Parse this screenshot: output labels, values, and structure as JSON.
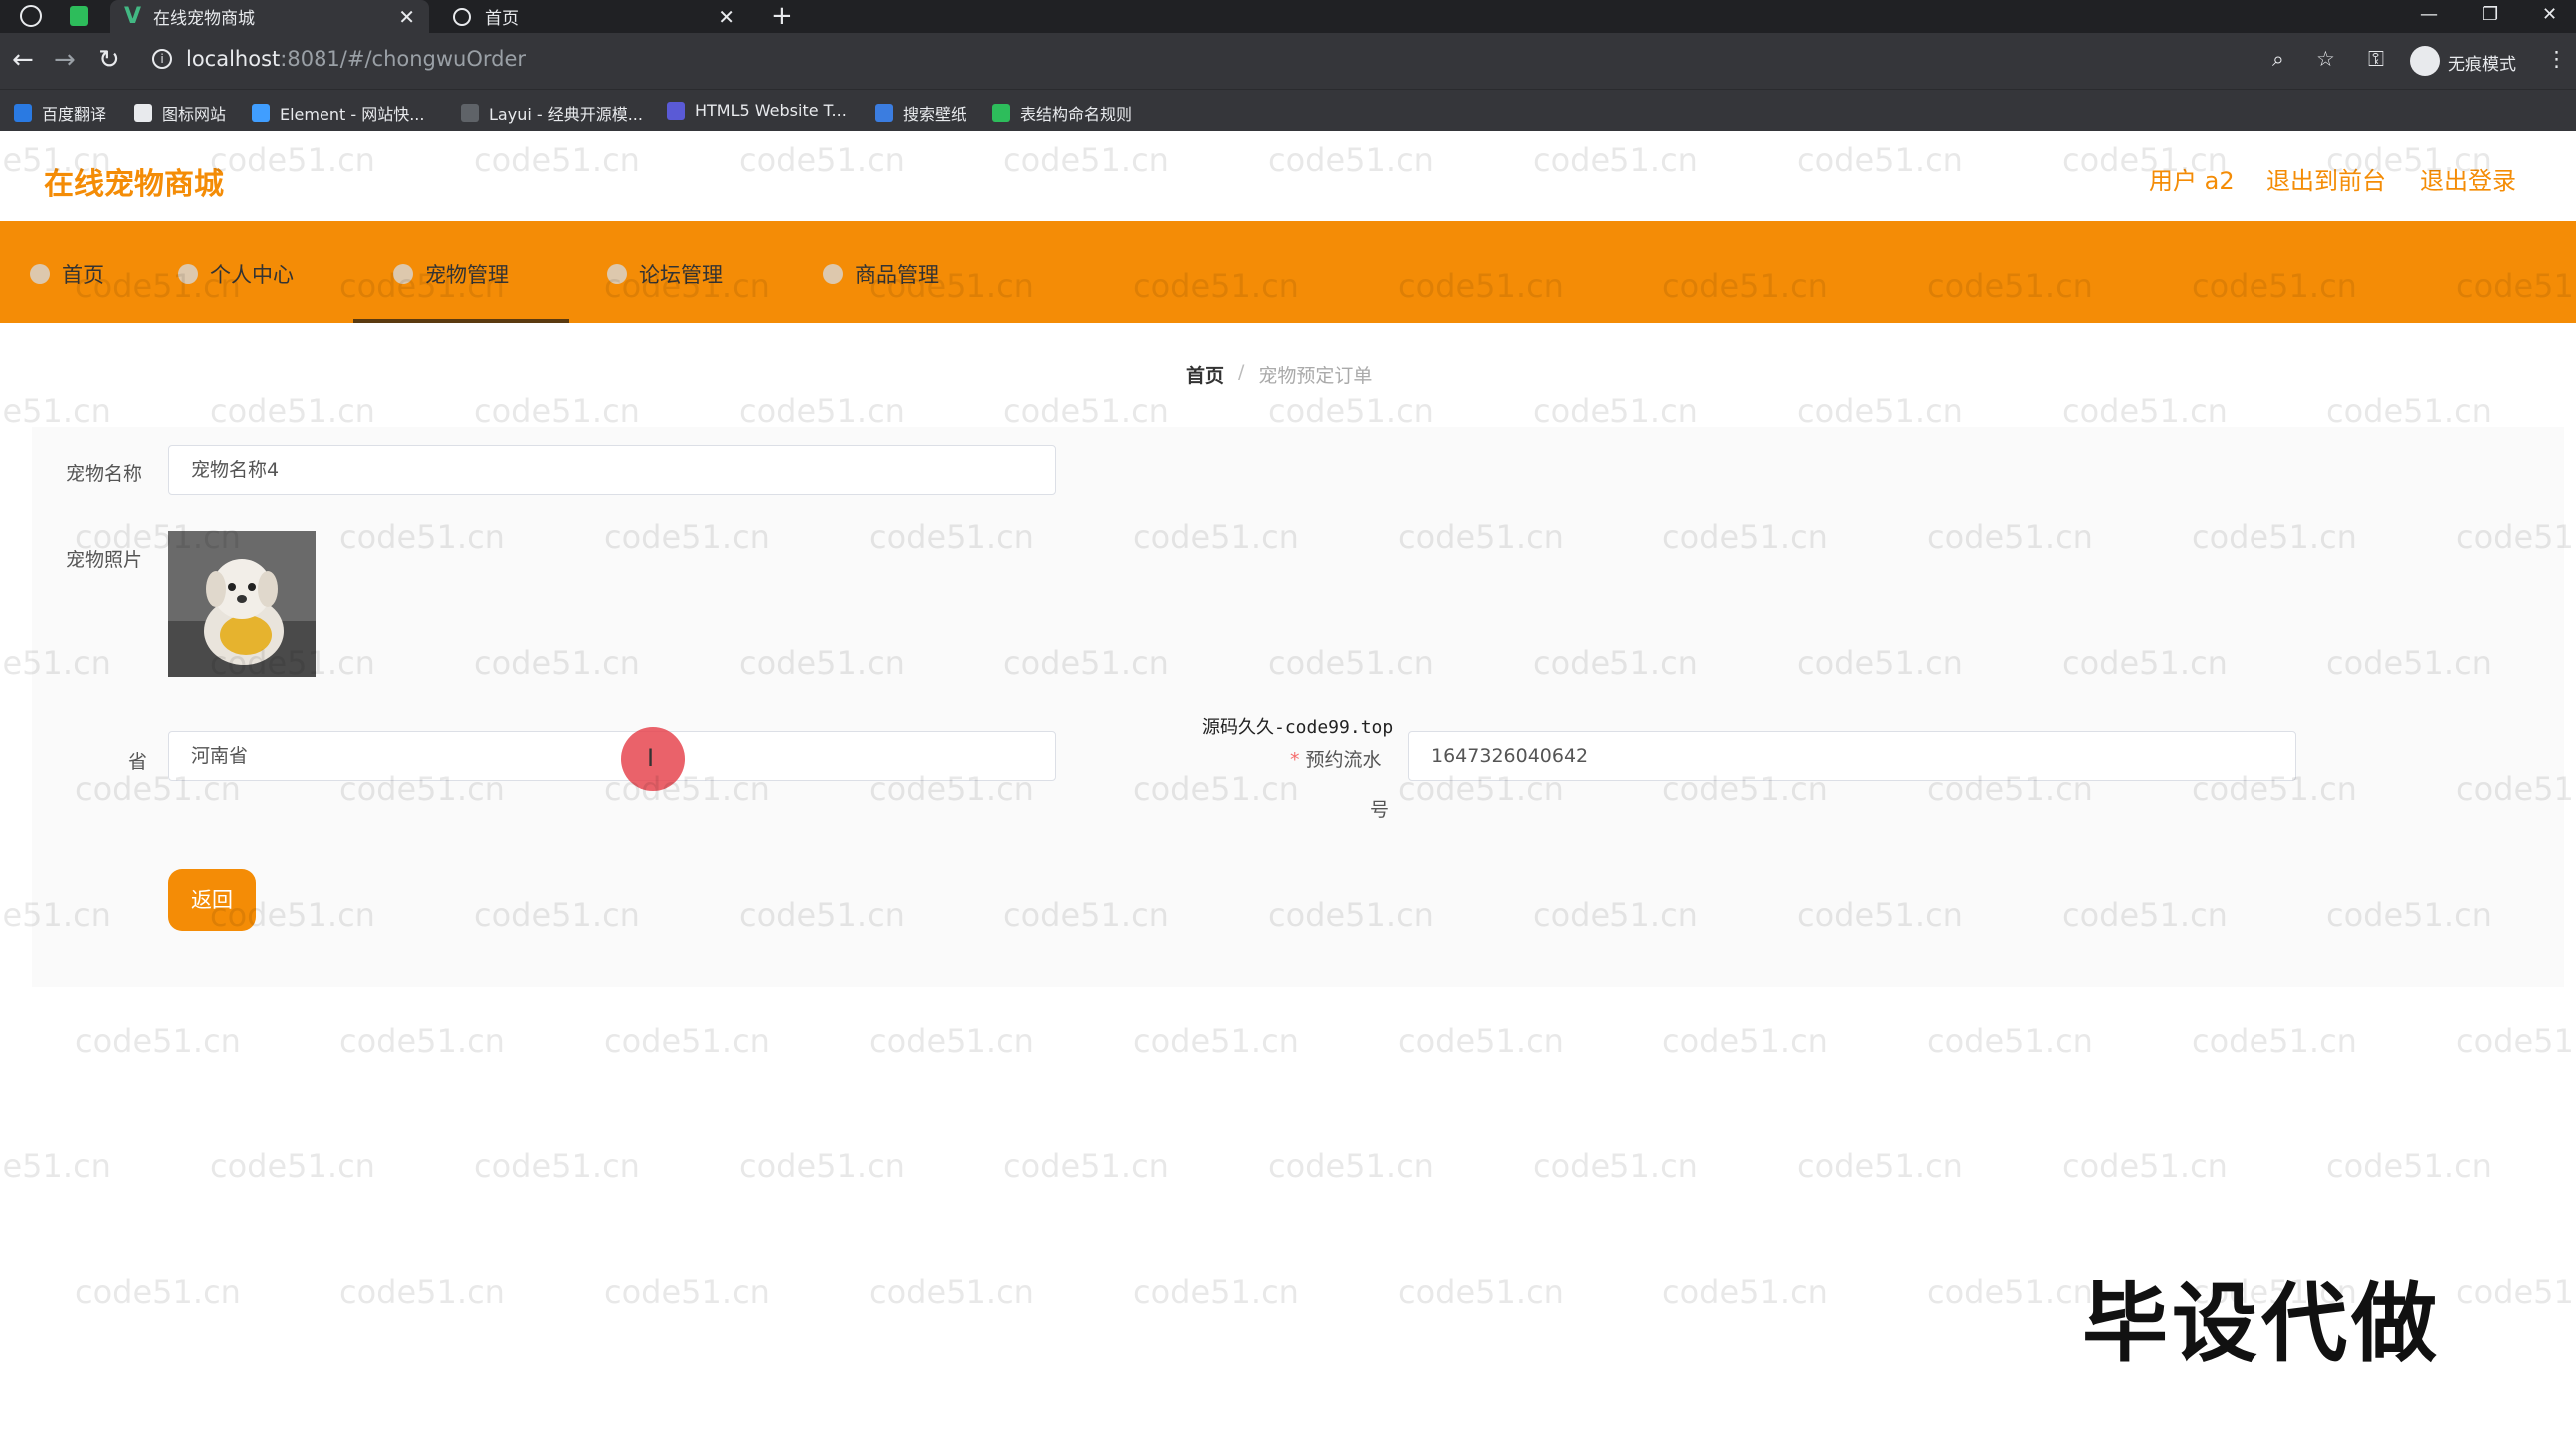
{
  "browser": {
    "tabs": [
      {
        "title": "在线宠物商城",
        "active": true
      },
      {
        "title": "首页",
        "active": false
      }
    ],
    "new_tab_symbol": "+",
    "url_host": "localhost",
    "url_rest": ":8081/#/chongwuOrder",
    "incognito_label": "无痕模式",
    "bookmarks": [
      {
        "label": "百度翻译",
        "color": "#2a7ae2"
      },
      {
        "label": "图标网站",
        "color": "#e8eaed"
      },
      {
        "label": "Element - 网站快...",
        "color": "#409eff"
      },
      {
        "label": "Layui - 经典开源模...",
        "color": "#e8eaed"
      },
      {
        "label": "HTML5 Website T...",
        "color": "#5a5ad6"
      },
      {
        "label": "搜索壁纸",
        "color": "#3b7de0"
      },
      {
        "label": "表结构命名规则",
        "color": "#2dbd5b"
      }
    ]
  },
  "header": {
    "site_title": "在线宠物商城",
    "user_label": "用户 a2",
    "back_to_front": "退出到前台",
    "logout": "退出登录",
    "accent_color": "#f48c06"
  },
  "nav": {
    "items": [
      {
        "label": "首页"
      },
      {
        "label": "个人中心"
      },
      {
        "label": "宠物管理",
        "active": true
      },
      {
        "label": "论坛管理"
      },
      {
        "label": "商品管理"
      }
    ]
  },
  "breadcrumb": {
    "home": "首页",
    "separator": "/",
    "current": "宠物预定订单"
  },
  "form": {
    "pet_name_label": "宠物名称",
    "pet_name_value": "宠物名称4",
    "pet_photo_label": "宠物照片",
    "province_label": "省",
    "province_value": "河南省",
    "serial_label_line1": "预约流水",
    "serial_label_line2": "号",
    "serial_value": "1647326040642",
    "back_button": "返回"
  },
  "overlay": {
    "promo_text": "源码久久-code99.top",
    "stamp_text": "毕设代做",
    "watermark_text": "code51.cn"
  }
}
